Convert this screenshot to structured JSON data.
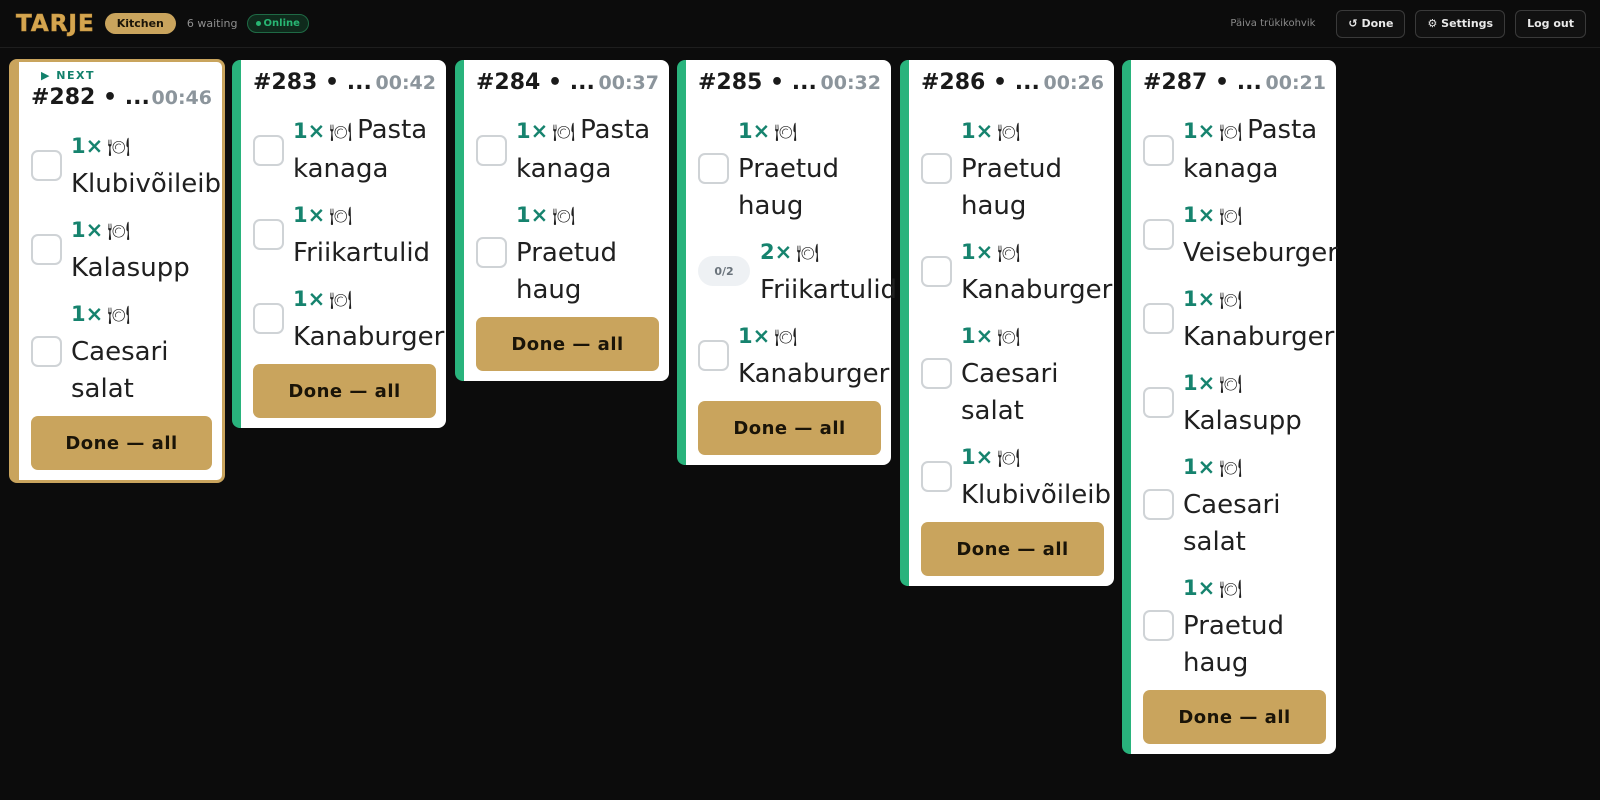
{
  "header": {
    "logo": "TARJE",
    "station": "Kitchen",
    "waiting": "6 waiting",
    "status": "Online",
    "place": "Päiva trükikohvik",
    "done_button": "↺ Done",
    "settings_button": "⚙ Settings",
    "logout_button": "Log out"
  },
  "next_label": "▶ NEXT",
  "done_all_label": "Done — all",
  "icons": {
    "item": "plate-icon"
  },
  "colors": {
    "gold": "#c9a45d",
    "green": "#29b37c",
    "qty": "#16836e"
  },
  "orders": [
    {
      "number": "#282 • ...",
      "time": "00:46",
      "items": [
        {
          "qty": "1×",
          "plate": "🍽",
          "name": "Klubivõileib"
        },
        {
          "qty": "1×",
          "plate": "🍽",
          "name": "Kalasupp"
        },
        {
          "qty": "1×",
          "plate": "🍽",
          "name": "Caesari salat"
        }
      ]
    },
    {
      "number": "#283 • ...",
      "time": "00:42",
      "items": [
        {
          "qty": "1×",
          "plate": "🍽",
          "name": "Pasta kanaga"
        },
        {
          "qty": "1×",
          "plate": "🍽",
          "name": "Friikartulid"
        },
        {
          "qty": "1×",
          "plate": "🍽",
          "name": "Kanaburger"
        }
      ]
    },
    {
      "number": "#284 • ...",
      "time": "00:37",
      "items": [
        {
          "qty": "1×",
          "plate": "🍽",
          "name": "Pasta kanaga"
        },
        {
          "qty": "1×",
          "plate": "🍽",
          "name": "Praetud haug"
        }
      ]
    },
    {
      "number": "#285 • ...",
      "time": "00:32",
      "items": [
        {
          "qty": "1×",
          "plate": "🍽",
          "name": "Praetud haug"
        },
        {
          "qty": "2×",
          "plate": "🍽",
          "name": "Friikartulid",
          "progress": "0/2"
        },
        {
          "qty": "1×",
          "plate": "🍽",
          "name": "Kanaburger"
        }
      ]
    },
    {
      "number": "#286 • ...",
      "time": "00:26",
      "items": [
        {
          "qty": "1×",
          "plate": "🍽",
          "name": "Praetud haug"
        },
        {
          "qty": "1×",
          "plate": "🍽",
          "name": "Kanaburger"
        },
        {
          "qty": "1×",
          "plate": "🍽",
          "name": "Caesari salat"
        },
        {
          "qty": "1×",
          "plate": "🍽",
          "name": "Klubivõileib"
        }
      ]
    },
    {
      "number": "#287 • ...",
      "time": "00:21",
      "items": [
        {
          "qty": "1×",
          "plate": "🍽",
          "name": "Pasta kanaga"
        },
        {
          "qty": "1×",
          "plate": "🍽",
          "name": "Veiseburger"
        },
        {
          "qty": "1×",
          "plate": "🍽",
          "name": "Kanaburger"
        },
        {
          "qty": "1×",
          "plate": "🍽",
          "name": "Kalasupp"
        },
        {
          "qty": "1×",
          "plate": "🍽",
          "name": "Caesari salat"
        },
        {
          "qty": "1×",
          "plate": "🍽",
          "name": "Praetud haug"
        }
      ]
    }
  ]
}
